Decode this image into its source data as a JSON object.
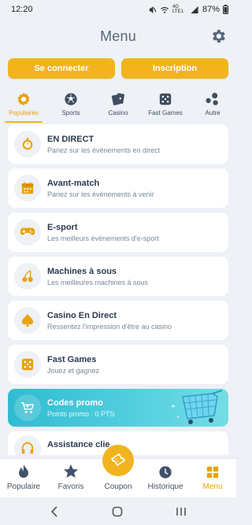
{
  "status": {
    "time": "12:20",
    "battery": "87%",
    "network": "4G LTE1"
  },
  "header": {
    "title": "Menu",
    "settings_icon": "gear-icon"
  },
  "auth": {
    "login_label": "Se connecter",
    "register_label": "Inscription"
  },
  "tabs": [
    {
      "label": "Populaires",
      "icon": "star-badge-icon",
      "active": true
    },
    {
      "label": "Sports",
      "icon": "soccer-ball-icon",
      "active": false
    },
    {
      "label": "Casino",
      "icon": "playing-cards-icon",
      "active": false
    },
    {
      "label": "Fast Games",
      "icon": "dice-icon",
      "active": false
    },
    {
      "label": "Autre",
      "icon": "dots-icon",
      "active": false
    }
  ],
  "items": [
    {
      "title": "EN DIRECT",
      "subtitle": "Pariez sur les événements en direct",
      "icon": "stopwatch-icon"
    },
    {
      "title": "Avant-match",
      "subtitle": "Pariez sur les événements à venir",
      "icon": "calendar-icon"
    },
    {
      "title": "E-sport",
      "subtitle": "Les meilleurs événements d'e-sport",
      "icon": "gamepad-icon"
    },
    {
      "title": "Machines à sous",
      "subtitle": "Les meilleures machines à sous",
      "icon": "cherries-icon"
    },
    {
      "title": "Casino En Direct",
      "subtitle": "Ressentez l'impression d'être au casino",
      "icon": "spade-icon"
    },
    {
      "title": "Fast Games",
      "subtitle": "Jouez et gagnez",
      "icon": "dice-icon"
    }
  ],
  "promo": {
    "title": "Codes promo",
    "subtitle": "Points promo : 0 PTS",
    "icon": "cart-icon"
  },
  "partial_item": {
    "title": "Assistance clie",
    "icon": "headset-icon"
  },
  "bottom_nav": [
    {
      "label": "Populaire",
      "icon": "flame-icon",
      "active": false
    },
    {
      "label": "Favoris",
      "icon": "star-icon",
      "active": false
    },
    {
      "label": "Coupon",
      "icon": "ticket-icon",
      "active": false
    },
    {
      "label": "Historique",
      "icon": "clock-icon",
      "active": false
    },
    {
      "label": "Menu",
      "icon": "grid-icon",
      "active": true
    }
  ],
  "colors": {
    "accent": "#f2b41e",
    "promo": "#2fbcd0",
    "background": "#eef1f5",
    "text": "#2b3a4e"
  }
}
